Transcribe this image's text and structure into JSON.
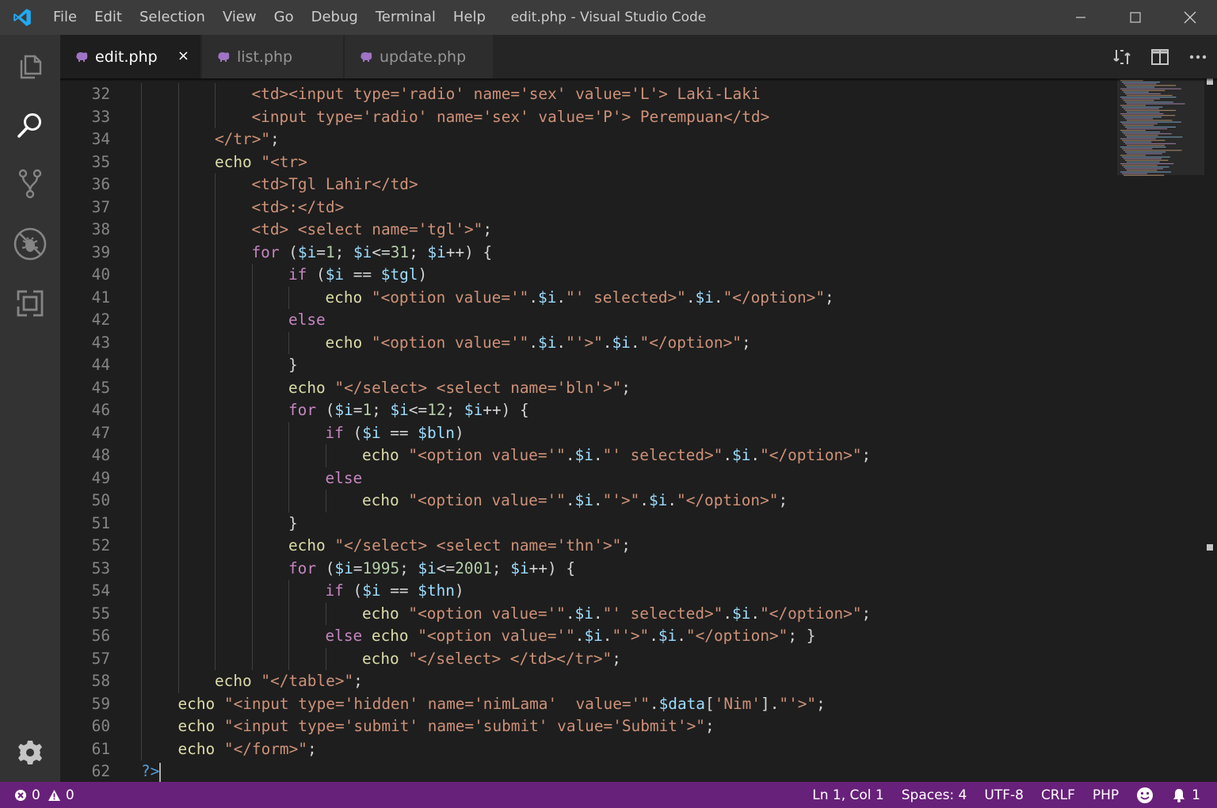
{
  "window": {
    "title": "edit.php - Visual Studio Code"
  },
  "menu": [
    "File",
    "Edit",
    "Selection",
    "View",
    "Go",
    "Debug",
    "Terminal",
    "Help"
  ],
  "tabs": [
    {
      "label": "edit.php",
      "active": true,
      "close": "×"
    },
    {
      "label": "list.php",
      "active": false
    },
    {
      "label": "update.php",
      "active": false
    }
  ],
  "activity_bar": [
    "files-icon",
    "search-icon",
    "source-control-icon",
    "debug-icon",
    "extensions-icon",
    "settings-gear-icon"
  ],
  "editor": {
    "first_line": 32,
    "lines": [
      {
        "n": "32",
        "indent": 3,
        "t": [
          [
            "s",
            "<td><input type='radio' name='sex' value='L'> Laki-Laki"
          ]
        ]
      },
      {
        "n": "33",
        "indent": 3,
        "t": [
          [
            "s",
            "<input type='radio' name='sex' value='P'> Perempuan</td>"
          ]
        ]
      },
      {
        "n": "34",
        "indent": 2,
        "t": [
          [
            "s",
            "</tr>\""
          ],
          [
            "p",
            ";"
          ]
        ]
      },
      {
        "n": "35",
        "indent": 2,
        "t": [
          [
            "f",
            "echo"
          ],
          [
            "p",
            " "
          ],
          [
            "s",
            "\"<tr>"
          ]
        ]
      },
      {
        "n": "36",
        "indent": 3,
        "t": [
          [
            "s",
            "<td>Tgl Lahir</td>"
          ]
        ]
      },
      {
        "n": "37",
        "indent": 3,
        "t": [
          [
            "s",
            "<td>:</td>"
          ]
        ]
      },
      {
        "n": "38",
        "indent": 3,
        "t": [
          [
            "s",
            "<td> <select name='tgl'>\""
          ],
          [
            "p",
            ";"
          ]
        ]
      },
      {
        "n": "39",
        "indent": 3,
        "t": [
          [
            "k",
            "for"
          ],
          [
            "p",
            " ("
          ],
          [
            "v",
            "$i"
          ],
          [
            "p",
            "="
          ],
          [
            "n",
            "1"
          ],
          [
            "p",
            "; "
          ],
          [
            "v",
            "$i"
          ],
          [
            "p",
            "<="
          ],
          [
            "n",
            "31"
          ],
          [
            "p",
            "; "
          ],
          [
            "v",
            "$i"
          ],
          [
            "p",
            "++) {"
          ]
        ]
      },
      {
        "n": "40",
        "indent": 4,
        "t": [
          [
            "k",
            "if"
          ],
          [
            "p",
            " ("
          ],
          [
            "v",
            "$i"
          ],
          [
            "p",
            " == "
          ],
          [
            "v",
            "$tgl"
          ],
          [
            "p",
            ")"
          ]
        ]
      },
      {
        "n": "41",
        "indent": 5,
        "t": [
          [
            "f",
            "echo"
          ],
          [
            "p",
            " "
          ],
          [
            "s",
            "\"<option value='\""
          ],
          [
            "p",
            "."
          ],
          [
            "v",
            "$i"
          ],
          [
            "p",
            "."
          ],
          [
            "s",
            "\"' selected>\""
          ],
          [
            "p",
            "."
          ],
          [
            "v",
            "$i"
          ],
          [
            "p",
            "."
          ],
          [
            "s",
            "\"</option>\""
          ],
          [
            "p",
            ";"
          ]
        ]
      },
      {
        "n": "42",
        "indent": 4,
        "t": [
          [
            "k",
            "else"
          ]
        ]
      },
      {
        "n": "43",
        "indent": 5,
        "t": [
          [
            "f",
            "echo"
          ],
          [
            "p",
            " "
          ],
          [
            "s",
            "\"<option value='\""
          ],
          [
            "p",
            "."
          ],
          [
            "v",
            "$i"
          ],
          [
            "p",
            "."
          ],
          [
            "s",
            "\"'>\""
          ],
          [
            "p",
            "."
          ],
          [
            "v",
            "$i"
          ],
          [
            "p",
            "."
          ],
          [
            "s",
            "\"</option>\""
          ],
          [
            "p",
            ";"
          ]
        ]
      },
      {
        "n": "44",
        "indent": 4,
        "t": [
          [
            "p",
            "}"
          ]
        ]
      },
      {
        "n": "45",
        "indent": 4,
        "t": [
          [
            "f",
            "echo"
          ],
          [
            "p",
            " "
          ],
          [
            "s",
            "\"</select> <select name='bln'>\""
          ],
          [
            "p",
            ";"
          ]
        ]
      },
      {
        "n": "46",
        "indent": 4,
        "t": [
          [
            "k",
            "for"
          ],
          [
            "p",
            " ("
          ],
          [
            "v",
            "$i"
          ],
          [
            "p",
            "="
          ],
          [
            "n",
            "1"
          ],
          [
            "p",
            "; "
          ],
          [
            "v",
            "$i"
          ],
          [
            "p",
            "<="
          ],
          [
            "n",
            "12"
          ],
          [
            "p",
            "; "
          ],
          [
            "v",
            "$i"
          ],
          [
            "p",
            "++) {"
          ]
        ]
      },
      {
        "n": "47",
        "indent": 5,
        "t": [
          [
            "k",
            "if"
          ],
          [
            "p",
            " ("
          ],
          [
            "v",
            "$i"
          ],
          [
            "p",
            " == "
          ],
          [
            "v",
            "$bln"
          ],
          [
            "p",
            ")"
          ]
        ]
      },
      {
        "n": "48",
        "indent": 6,
        "t": [
          [
            "f",
            "echo"
          ],
          [
            "p",
            " "
          ],
          [
            "s",
            "\"<option value='\""
          ],
          [
            "p",
            "."
          ],
          [
            "v",
            "$i"
          ],
          [
            "p",
            "."
          ],
          [
            "s",
            "\"' selected>\""
          ],
          [
            "p",
            "."
          ],
          [
            "v",
            "$i"
          ],
          [
            "p",
            "."
          ],
          [
            "s",
            "\"</option>\""
          ],
          [
            "p",
            ";"
          ]
        ]
      },
      {
        "n": "49",
        "indent": 5,
        "t": [
          [
            "k",
            "else"
          ]
        ]
      },
      {
        "n": "50",
        "indent": 6,
        "t": [
          [
            "f",
            "echo"
          ],
          [
            "p",
            " "
          ],
          [
            "s",
            "\"<option value='\""
          ],
          [
            "p",
            "."
          ],
          [
            "v",
            "$i"
          ],
          [
            "p",
            "."
          ],
          [
            "s",
            "\"'>\""
          ],
          [
            "p",
            "."
          ],
          [
            "v",
            "$i"
          ],
          [
            "p",
            "."
          ],
          [
            "s",
            "\"</option>\""
          ],
          [
            "p",
            ";"
          ]
        ]
      },
      {
        "n": "51",
        "indent": 4,
        "t": [
          [
            "p",
            "}"
          ]
        ]
      },
      {
        "n": "52",
        "indent": 4,
        "t": [
          [
            "f",
            "echo"
          ],
          [
            "p",
            " "
          ],
          [
            "s",
            "\"</select> <select name='thn'>\""
          ],
          [
            "p",
            ";"
          ]
        ]
      },
      {
        "n": "53",
        "indent": 4,
        "t": [
          [
            "k",
            "for"
          ],
          [
            "p",
            " ("
          ],
          [
            "v",
            "$i"
          ],
          [
            "p",
            "="
          ],
          [
            "n",
            "1995"
          ],
          [
            "p",
            "; "
          ],
          [
            "v",
            "$i"
          ],
          [
            "p",
            "<="
          ],
          [
            "n",
            "2001"
          ],
          [
            "p",
            "; "
          ],
          [
            "v",
            "$i"
          ],
          [
            "p",
            "++) {"
          ]
        ]
      },
      {
        "n": "54",
        "indent": 5,
        "t": [
          [
            "k",
            "if"
          ],
          [
            "p",
            " ("
          ],
          [
            "v",
            "$i"
          ],
          [
            "p",
            " == "
          ],
          [
            "v",
            "$thn"
          ],
          [
            "p",
            ")"
          ]
        ]
      },
      {
        "n": "55",
        "indent": 6,
        "t": [
          [
            "f",
            "echo"
          ],
          [
            "p",
            " "
          ],
          [
            "s",
            "\"<option value='\""
          ],
          [
            "p",
            "."
          ],
          [
            "v",
            "$i"
          ],
          [
            "p",
            "."
          ],
          [
            "s",
            "\"' selected>\""
          ],
          [
            "p",
            "."
          ],
          [
            "v",
            "$i"
          ],
          [
            "p",
            "."
          ],
          [
            "s",
            "\"</option>\""
          ],
          [
            "p",
            ";"
          ]
        ]
      },
      {
        "n": "56",
        "indent": 5,
        "t": [
          [
            "k",
            "else"
          ],
          [
            "p",
            " "
          ],
          [
            "f",
            "echo"
          ],
          [
            "p",
            " "
          ],
          [
            "s",
            "\"<option value='\""
          ],
          [
            "p",
            "."
          ],
          [
            "v",
            "$i"
          ],
          [
            "p",
            "."
          ],
          [
            "s",
            "\"'>\""
          ],
          [
            "p",
            "."
          ],
          [
            "v",
            "$i"
          ],
          [
            "p",
            "."
          ],
          [
            "s",
            "\"</option>\""
          ],
          [
            "p",
            "; }"
          ]
        ]
      },
      {
        "n": "57",
        "indent": 6,
        "t": [
          [
            "f",
            "echo"
          ],
          [
            "p",
            " "
          ],
          [
            "s",
            "\"</select> </td></tr>\""
          ],
          [
            "p",
            ";"
          ]
        ]
      },
      {
        "n": "58",
        "indent": 2,
        "t": [
          [
            "f",
            "echo"
          ],
          [
            "p",
            " "
          ],
          [
            "s",
            "\"</table>\""
          ],
          [
            "p",
            ";"
          ]
        ]
      },
      {
        "n": "59",
        "indent": 1,
        "t": [
          [
            "f",
            "echo"
          ],
          [
            "p",
            " "
          ],
          [
            "s",
            "\"<input type='hidden' name='nimLama'  value='\""
          ],
          [
            "p",
            "."
          ],
          [
            "v",
            "$data"
          ],
          [
            "p",
            "["
          ],
          [
            "s",
            "'Nim'"
          ],
          [
            "p",
            "]."
          ],
          [
            "s",
            "\"'>\""
          ],
          [
            "p",
            ";"
          ]
        ]
      },
      {
        "n": "60",
        "indent": 1,
        "t": [
          [
            "f",
            "echo"
          ],
          [
            "p",
            " "
          ],
          [
            "s",
            "\"<input type='submit' name='submit' value='Submit'>\""
          ],
          [
            "p",
            ";"
          ]
        ]
      },
      {
        "n": "61",
        "indent": 1,
        "t": [
          [
            "f",
            "echo"
          ],
          [
            "p",
            " "
          ],
          [
            "s",
            "\"</form>\""
          ],
          [
            "p",
            ";"
          ]
        ]
      },
      {
        "n": "62",
        "indent": 0,
        "t": [
          [
            "tag",
            "?>"
          ]
        ]
      }
    ]
  },
  "status": {
    "errors": "0",
    "warnings": "0",
    "position": "Ln 1, Col 1",
    "spaces": "Spaces: 4",
    "encoding": "UTF-8",
    "eol": "CRLF",
    "language": "PHP",
    "notifications": "1"
  },
  "colors": {
    "statusbar": "#68217a",
    "activitybar": "#333333",
    "editor_bg": "#1e1e1e",
    "titlebar": "#3c3c3c",
    "php_icon": "#a074c4"
  }
}
